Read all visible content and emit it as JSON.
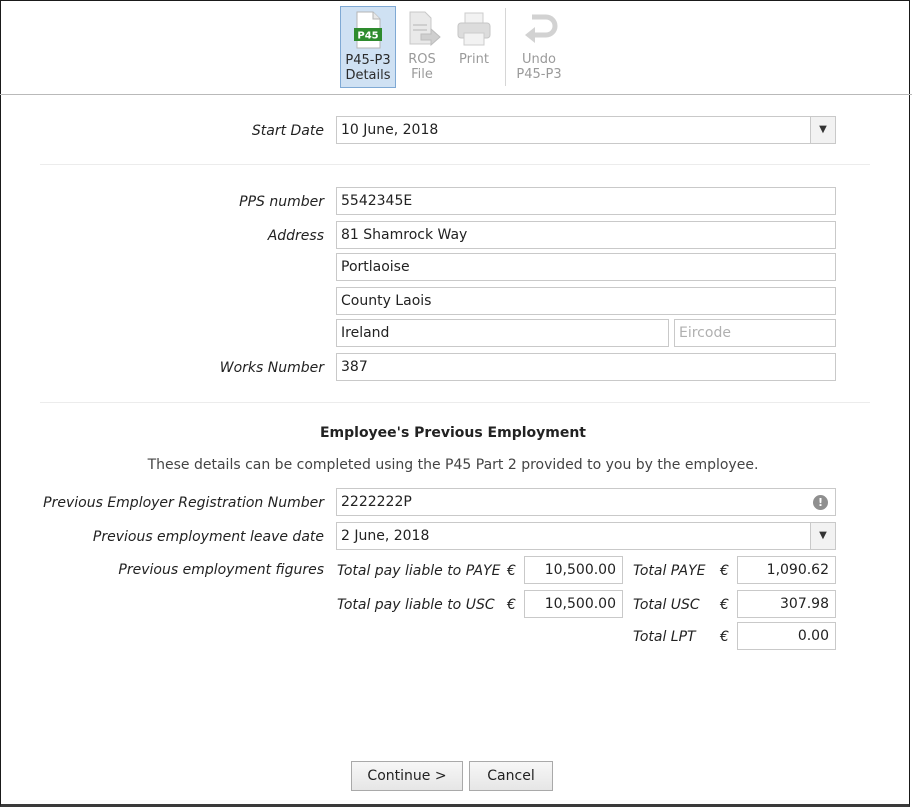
{
  "toolbar": {
    "buttons": [
      {
        "label1": "P45-P3",
        "label2": "Details",
        "icon": "p45-document-icon",
        "badge": "P45"
      },
      {
        "label1": "ROS",
        "label2": "File",
        "icon": "ros-file-icon"
      },
      {
        "label1": "Print",
        "label2": "",
        "icon": "printer-icon"
      },
      {
        "label1": "Undo",
        "label2": "P45-P3",
        "icon": "undo-icon"
      }
    ]
  },
  "form": {
    "start_date_label": "Start Date",
    "start_date_value": "10 June, 2018",
    "pps_label": "PPS number",
    "pps_value": "5542345E",
    "address_label": "Address",
    "address_lines": [
      "81 Shamrock Way",
      "Portlaoise",
      "County Laois",
      "Ireland"
    ],
    "eircode_placeholder": "Eircode",
    "works_label": "Works Number",
    "works_value": "387"
  },
  "previous": {
    "heading": "Employee's Previous Employment",
    "note": "These details can be completed using the P45 Part 2 provided to you by the employee.",
    "reg_label": "Previous Employer Registration Number",
    "reg_value": "2222222P",
    "warn_symbol": "!",
    "leave_label": "Previous employment leave date",
    "leave_value": "2 June, 2018",
    "figures_label": "Previous employment figures",
    "currency": "€",
    "pay_paye_label": "Total pay liable to PAYE",
    "pay_paye_value": "10,500.00",
    "total_paye_label": "Total PAYE",
    "total_paye_value": "1,090.62",
    "pay_usc_label": "Total pay liable to USC",
    "pay_usc_value": "10,500.00",
    "total_usc_label": "Total USC",
    "total_usc_value": "307.98",
    "total_lpt_label": "Total LPT",
    "total_lpt_value": "0.00"
  },
  "actions": {
    "continue_label": "Continue >",
    "cancel_label": "Cancel"
  },
  "colors": {
    "active_bg": "#cfe1f3",
    "badge_green": "#2e8b2e",
    "border": "#c9c9c9"
  }
}
